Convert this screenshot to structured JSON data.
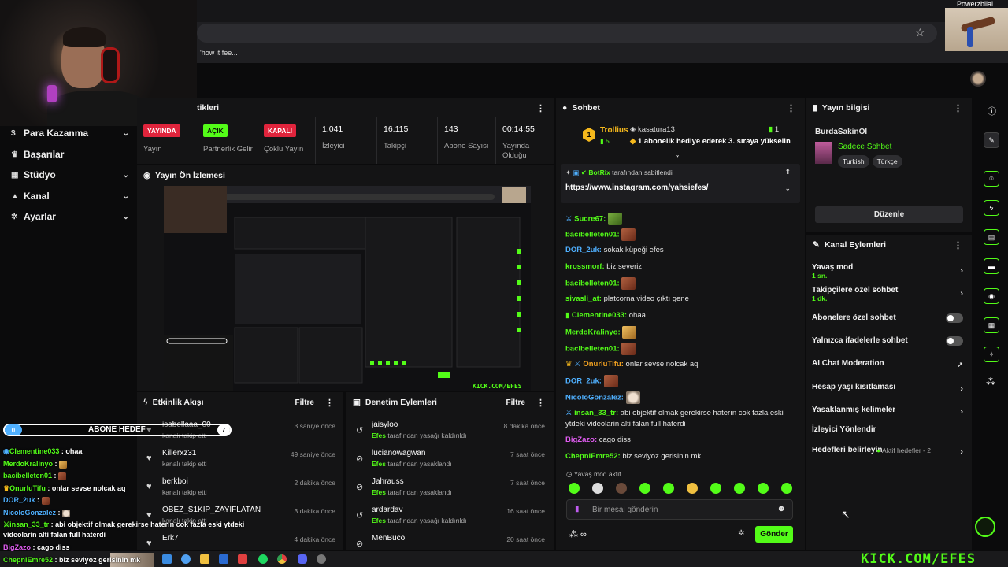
{
  "browser": {
    "bookmark": "'how it fee...",
    "corner_name": "Powerzbilal"
  },
  "sidebar": {
    "items": [
      {
        "label": "Para Kazanma",
        "icon": "dollar-icon",
        "chev": "⌄"
      },
      {
        "label": "Başarılar",
        "icon": "trophy-icon",
        "chev": ""
      },
      {
        "label": "Stüdyo",
        "icon": "studio-icon",
        "chev": "⌄"
      },
      {
        "label": "Kanal",
        "icon": "person-icon",
        "chev": "⌄"
      },
      {
        "label": "Ayarlar",
        "icon": "gear-icon",
        "chev": "⌄"
      }
    ]
  },
  "stats_panel": {
    "title": "tikleri"
  },
  "stats": [
    {
      "badge": "YAYINDA",
      "label": "Yayın"
    },
    {
      "badge": "AÇIK",
      "label": "Partnerlik Gelir"
    },
    {
      "badge": "KAPALI",
      "label": "Çoklu Yayın"
    },
    {
      "value": "1.041",
      "label": "İzleyici"
    },
    {
      "value": "16.115",
      "label": "Takipçi"
    },
    {
      "value": "143",
      "label": "Abone Sayısı"
    },
    {
      "value": "00:14:55",
      "label": "Yayında Olduğu"
    }
  ],
  "preview": {
    "title": "Yayın Ön İzlemesi",
    "watermark": "KICK.COM/EFES"
  },
  "activity": {
    "title": "Etkinlik Akışı",
    "filter": "Filtre",
    "rows": [
      {
        "name": "isabellaaa_00",
        "sub": "kanalı takip etti",
        "time": "3 saniye önce"
      },
      {
        "name": "Killerxz31",
        "sub": "kanalı takip etti",
        "time": "49 saniye önce"
      },
      {
        "name": "berkboi",
        "sub": "kanalı takip etti",
        "time": "2 dakika önce"
      },
      {
        "name": "OBEZ_S1KIP_ZAYIFLATAN",
        "sub": "kanalı takip etti",
        "time": "3 dakika önce"
      },
      {
        "name": "Erk7",
        "sub": "kanalı takip etti",
        "time": "4 dakika önce"
      }
    ]
  },
  "moderation": {
    "title": "Denetim Eylemleri",
    "filter": "Filtre",
    "rows": [
      {
        "name": "jaisyloo",
        "by": "Efes",
        "sub": "tarafından yasağı kaldırıldı",
        "time": "8 dakika önce"
      },
      {
        "name": "lucianowagwan",
        "by": "Efes",
        "sub": "tarafından yasaklandı",
        "time": "7 saat önce"
      },
      {
        "name": "Jahrauss",
        "by": "Efes",
        "sub": "tarafından yasaklandı",
        "time": "7 saat önce"
      },
      {
        "name": "ardardav",
        "by": "Efes",
        "sub": "tarafından yasağı kaldırıldı",
        "time": "16 saat önce"
      },
      {
        "name": "MenBuco",
        "by": "",
        "sub": "",
        "time": "20 saat önce"
      }
    ]
  },
  "chat": {
    "title": "Sohbet",
    "gift": {
      "badge": "1",
      "name": "Trollius",
      "count": "5",
      "gifter": "kasatura13",
      "gift_count": "1",
      "text": "1 abonelik hediye ederek 3. sıraya yükselin"
    },
    "pinned": {
      "by": "BotRix",
      "by_text": "tarafından sabitlendi",
      "link": "https://www.instagram.com/yahsiefes/"
    },
    "messages": [
      {
        "user": "Sucre67:",
        "color": "#53fc18",
        "text": "",
        "emote": "pepe"
      },
      {
        "user": "bacibelleten01:",
        "color": "#53fc18",
        "text": "",
        "emote": "face"
      },
      {
        "user": "DOR_2uk:",
        "color": "#4fb0ff",
        "text": "sokak küpeği efes",
        "emote": ""
      },
      {
        "user": "krossmorf:",
        "color": "#53fc18",
        "text": "biz severiz",
        "emote": ""
      },
      {
        "user": "bacibelleten01:",
        "color": "#53fc18",
        "text": "",
        "emote": "face"
      },
      {
        "user": "sivasli_at:",
        "color": "#53fc18",
        "text": "platcorna video çıktı gene",
        "emote": ""
      },
      {
        "user": "Clementine033:",
        "color": "#53fc18",
        "text": "ohaa",
        "emote": ""
      },
      {
        "user": "MerdoKralinyo:",
        "color": "#53fc18",
        "text": "",
        "emote": "dog"
      },
      {
        "user": "bacibelleten01:",
        "color": "#53fc18",
        "text": "",
        "emote": "face"
      },
      {
        "user": "OnurluTifu:",
        "color": "#f0a020",
        "text": "onlar sevse nolcak aq",
        "emote": ""
      },
      {
        "user": "DOR_2uk:",
        "color": "#4fb0ff",
        "text": "",
        "emote": "face"
      },
      {
        "user": "NicoloGonzalez:",
        "color": "#4fb0ff",
        "text": "",
        "emote": "cat"
      },
      {
        "user": "insan_33_tr:",
        "color": "#53fc18",
        "text": "abi objektif olmak gerekirse haterın cok fazla eski ytdeki videolarin alti falan full haterdi",
        "emote": ""
      },
      {
        "user": "BigZazo:",
        "color": "#e05cf0",
        "text": "cago diss",
        "emote": ""
      },
      {
        "user": "ChepniEmre52:",
        "color": "#53fc18",
        "text": "biz seviyoz gerisinin mk",
        "emote": ""
      }
    ],
    "slow_mode": "Yavaş mod aktif",
    "input_placeholder": "Bir mesaj gönderin",
    "send": "Gönder"
  },
  "stream_info": {
    "title": "Yayın bilgisi",
    "stream_title": "BurdaSakinOl",
    "category": "Sadece Sohbet",
    "tags": [
      "Turkish",
      "Türkçe"
    ],
    "edit": "Düzenle"
  },
  "channel_actions": {
    "title": "Kanal Eylemleri",
    "rows": [
      {
        "label": "Yavaş mod",
        "sub": "1 sn.",
        "control": "chev"
      },
      {
        "label": "Takipçilere özel sohbet",
        "sub": "1 dk.",
        "control": "chev"
      },
      {
        "label": "Abonelere özel sohbet",
        "sub": "",
        "control": "toggle"
      },
      {
        "label": "Yalnızca ifadelerle sohbet",
        "sub": "",
        "control": "toggle"
      },
      {
        "label": "AI Chat Moderation",
        "sub": "",
        "control": "ext"
      },
      {
        "label": "Hesap yaşı kısıtlaması",
        "sub": "",
        "control": "chev"
      },
      {
        "label": "Yasaklanmış kelimeler",
        "sub": "",
        "control": "chev"
      },
      {
        "label": "İzleyici Yönlendir",
        "sub": "",
        "control": ""
      },
      {
        "label": "Hedefleri belirleyin",
        "sub": "",
        "control": "chev",
        "extra": "Aktif hedefler - 2"
      }
    ]
  },
  "overlay": {
    "goal_current": "0",
    "goal_label": "ABONE HEDEF",
    "goal_target": "7",
    "goal_progress": 0.0,
    "messages": [
      {
        "user": "Clementine033",
        "text": ": ohaa"
      },
      {
        "user": "MerdoKralinyo",
        "text": ":"
      },
      {
        "user": "bacibelleten01",
        "text": ":"
      },
      {
        "user": "OnurluTifu",
        "text": ": onlar sevse nolcak aq"
      },
      {
        "user": "DOR_2uk",
        "text": ":"
      },
      {
        "user": "NicoloGonzalez",
        "text": ":"
      },
      {
        "user": "insan_33_tr",
        "text": ": abi objektif olmak gerekirse haterın cok fazla eski ytdeki"
      },
      {
        "user": "",
        "text": "videolarin alti falan full haterdi"
      },
      {
        "user": "BigZazo",
        "text": ": cago diss"
      },
      {
        "user": "ChepniEmre52",
        "text": ": biz seviyoz gerisinin mk"
      }
    ]
  },
  "footer": {
    "kick_logo": "KICK.COM/EFES"
  },
  "colors": {
    "accent": "#53fc18",
    "live_red": "#e0243c",
    "bg": "#0b0b0c",
    "panel": "#141415"
  }
}
